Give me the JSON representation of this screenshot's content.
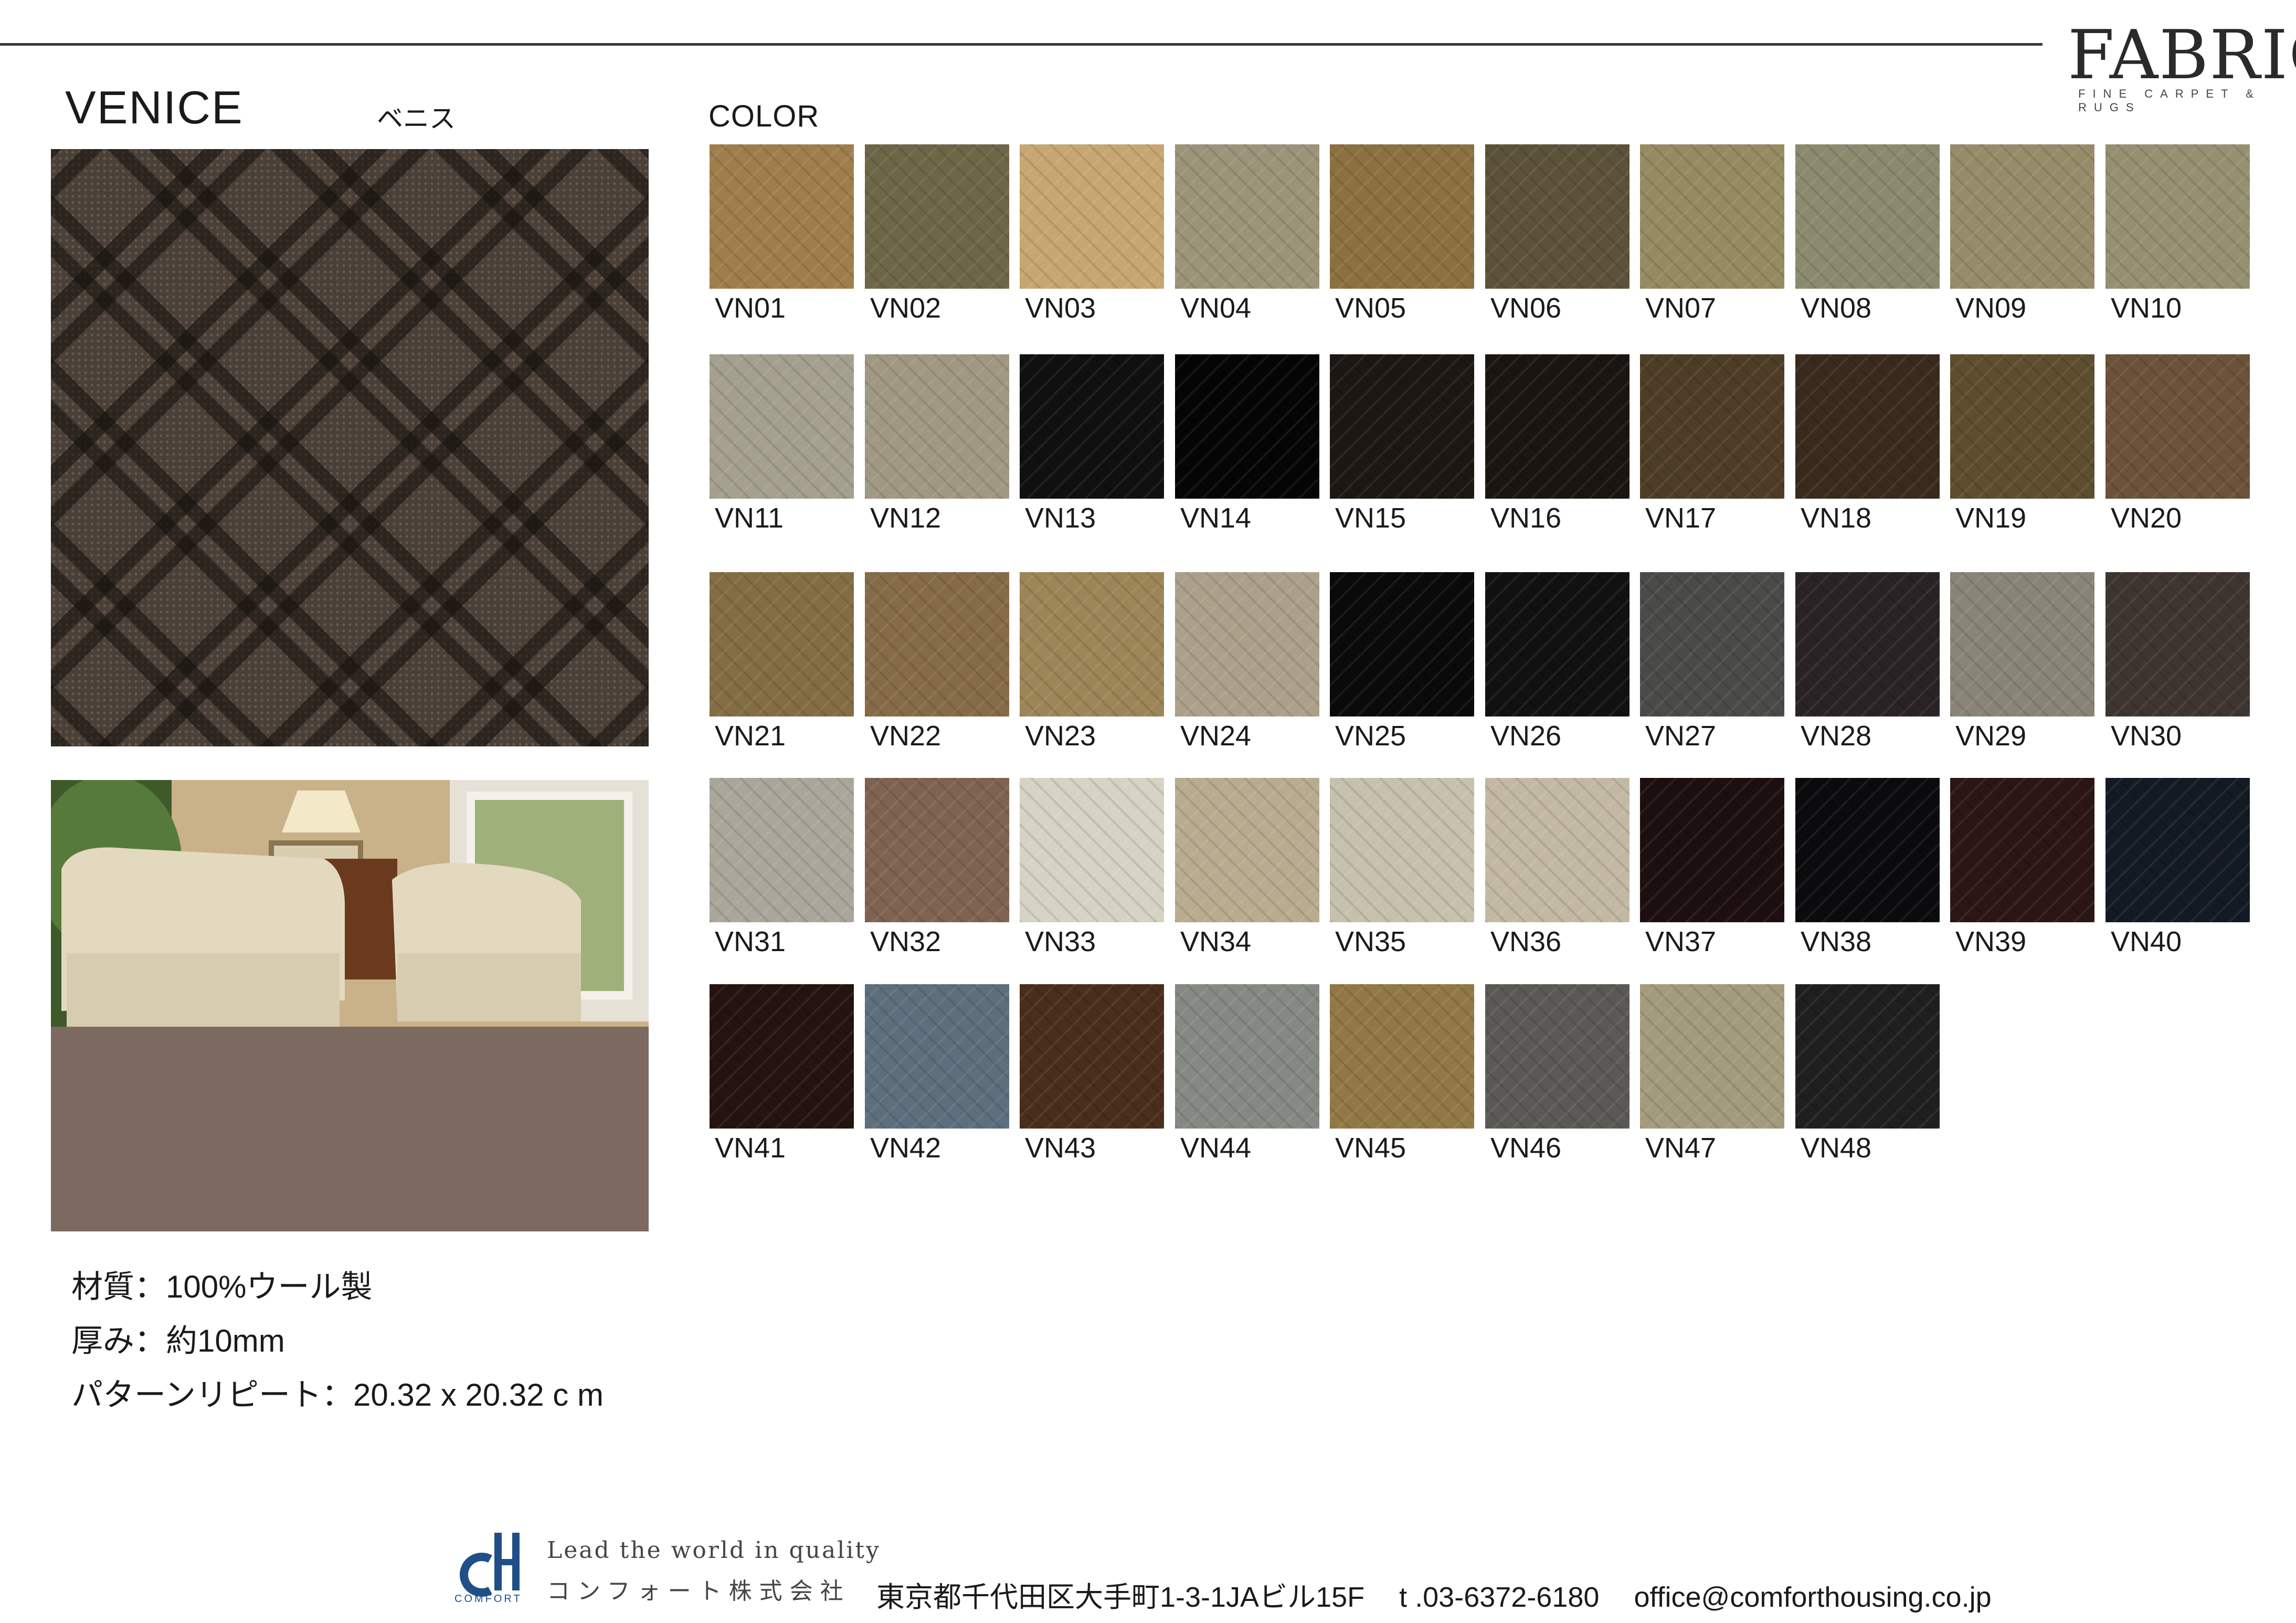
{
  "brand": {
    "name": "FABRICA",
    "subtitle": "FINE CARPET & RUGS"
  },
  "product": {
    "name": "VENICE",
    "name_kana": "ベニス"
  },
  "specs": [
    "材質：100%ウール製",
    "厚み：約10mm",
    "パターンリピート：20.32 x 20.32 c m"
  ],
  "colors_heading": "COLOR",
  "colors": [
    {
      "code": "VN01",
      "hex": "#a07e4b"
    },
    {
      "code": "VN02",
      "hex": "#6d6647"
    },
    {
      "code": "VN03",
      "hex": "#c7a771"
    },
    {
      "code": "VN04",
      "hex": "#9b9478"
    },
    {
      "code": "VN05",
      "hex": "#8d703f"
    },
    {
      "code": "VN06",
      "hex": "#5c523a"
    },
    {
      "code": "VN07",
      "hex": "#958a60"
    },
    {
      "code": "VN08",
      "hex": "#8b8a6e"
    },
    {
      "code": "VN09",
      "hex": "#968c6a"
    },
    {
      "code": "VN10",
      "hex": "#969071"
    },
    {
      "code": "VN11",
      "hex": "#a49f8e"
    },
    {
      "code": "VN12",
      "hex": "#a09882"
    },
    {
      "code": "VN13",
      "hex": "#101010"
    },
    {
      "code": "VN14",
      "hex": "#050505"
    },
    {
      "code": "VN15",
      "hex": "#1c1712"
    },
    {
      "code": "VN16",
      "hex": "#1a1511"
    },
    {
      "code": "VN17",
      "hex": "#4e3d26"
    },
    {
      "code": "VN18",
      "hex": "#3a2a1d"
    },
    {
      "code": "VN19",
      "hex": "#5e4e30"
    },
    {
      "code": "VN20",
      "hex": "#6b5238"
    },
    {
      "code": "VN21",
      "hex": "#836d43"
    },
    {
      "code": "VN22",
      "hex": "#866b47"
    },
    {
      "code": "VN23",
      "hex": "#9c8557"
    },
    {
      "code": "VN24",
      "hex": "#aba08a"
    },
    {
      "code": "VN25",
      "hex": "#0a0a0a"
    },
    {
      "code": "VN26",
      "hex": "#111111"
    },
    {
      "code": "VN27",
      "hex": "#4a4a48"
    },
    {
      "code": "VN28",
      "hex": "#2a2325"
    },
    {
      "code": "VN29",
      "hex": "#898477"
    },
    {
      "code": "VN30",
      "hex": "#3e3530"
    },
    {
      "code": "VN31",
      "hex": "#aaa69b"
    },
    {
      "code": "VN32",
      "hex": "#7f6350"
    },
    {
      "code": "VN33",
      "hex": "#d6d3c4"
    },
    {
      "code": "VN34",
      "hex": "#b9ab8f"
    },
    {
      "code": "VN35",
      "hex": "#c6c1ad"
    },
    {
      "code": "VN36",
      "hex": "#c3b9a3"
    },
    {
      "code": "VN37",
      "hex": "#1d0f10"
    },
    {
      "code": "VN38",
      "hex": "#0b0b0d"
    },
    {
      "code": "VN39",
      "hex": "#2c1614"
    },
    {
      "code": "VN40",
      "hex": "#141a24"
    },
    {
      "code": "VN41",
      "hex": "#24130f"
    },
    {
      "code": "VN42",
      "hex": "#5d6e7c"
    },
    {
      "code": "VN43",
      "hex": "#4a2d1a"
    },
    {
      "code": "VN44",
      "hex": "#858983"
    },
    {
      "code": "VN45",
      "hex": "#917845"
    },
    {
      "code": "VN46",
      "hex": "#5a5955"
    },
    {
      "code": "VN47",
      "hex": "#a29b7c"
    },
    {
      "code": "VN48",
      "hex": "#1f1f1f"
    }
  ],
  "footer": {
    "logo_text": "COMFORT",
    "tagline": "Lead the world in quality",
    "company": "コンフォート株式会社",
    "address": "東京都千代田区大手町1-3-1JAビル15F",
    "phone": "t .03-6372-6180",
    "email": "office@comforthousing.co.jp"
  }
}
